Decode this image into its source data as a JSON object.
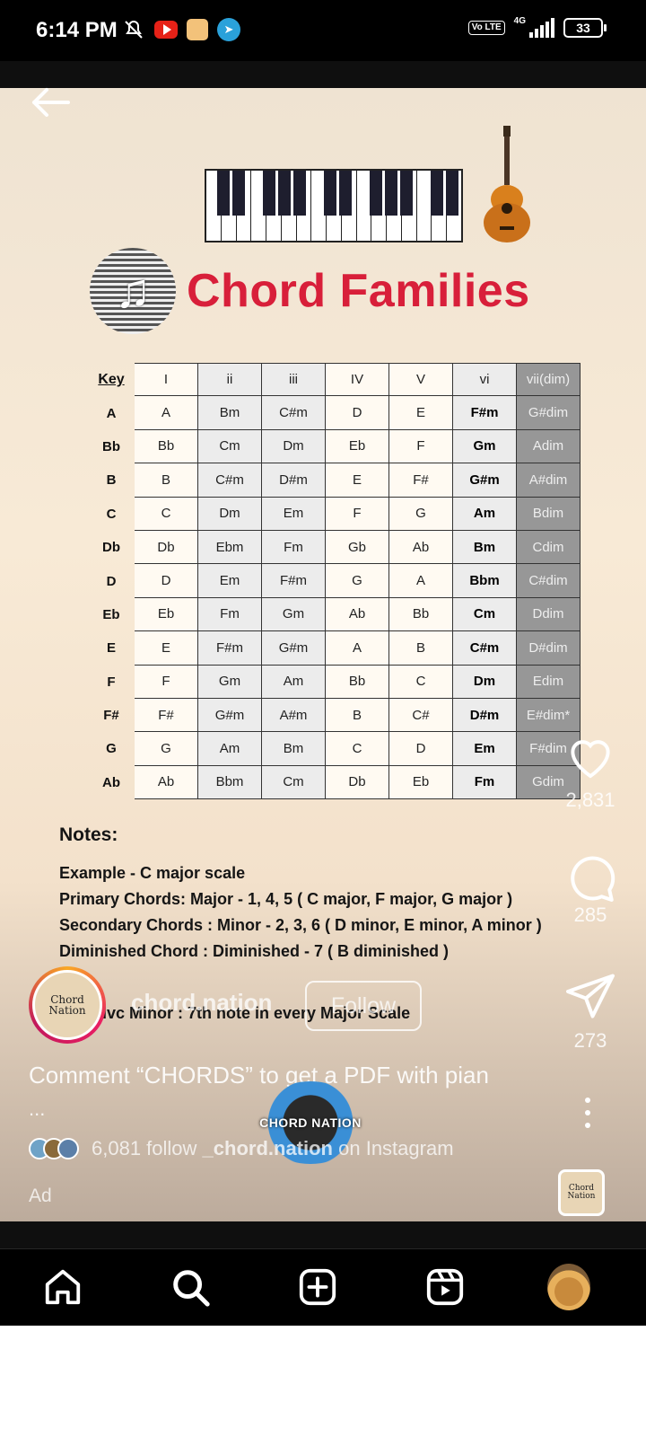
{
  "status_bar": {
    "time": "6:14 PM",
    "network": "4G",
    "volte": "Vo LTE",
    "battery": "33",
    "icons": [
      "mute-icon",
      "youtube-icon",
      "amazon-icon",
      "telegram-icon"
    ]
  },
  "post": {
    "title": "Chord Families",
    "table": {
      "key_header": "Key",
      "degrees": [
        "I",
        "ii",
        "iii",
        "IV",
        "V",
        "vi",
        "vii(dim)"
      ],
      "rows": [
        {
          "key": "A",
          "chords": [
            "A",
            "Bm",
            "C#m",
            "D",
            "E",
            "F#m",
            "G#dim"
          ]
        },
        {
          "key": "Bb",
          "chords": [
            "Bb",
            "Cm",
            "Dm",
            "Eb",
            "F",
            "Gm",
            "Adim"
          ]
        },
        {
          "key": "B",
          "chords": [
            "B",
            "C#m",
            "D#m",
            "E",
            "F#",
            "G#m",
            "A#dim"
          ]
        },
        {
          "key": "C",
          "chords": [
            "C",
            "Dm",
            "Em",
            "F",
            "G",
            "Am",
            "Bdim"
          ]
        },
        {
          "key": "Db",
          "chords": [
            "Db",
            "Ebm",
            "Fm",
            "Gb",
            "Ab",
            "Bm",
            "Cdim"
          ]
        },
        {
          "key": "D",
          "chords": [
            "D",
            "Em",
            "F#m",
            "G",
            "A",
            "Bbm",
            "C#dim"
          ]
        },
        {
          "key": "Eb",
          "chords": [
            "Eb",
            "Fm",
            "Gm",
            "Ab",
            "Bb",
            "Cm",
            "Ddim"
          ]
        },
        {
          "key": "E",
          "chords": [
            "E",
            "F#m",
            "G#m",
            "A",
            "B",
            "C#m",
            "D#dim"
          ]
        },
        {
          "key": "F",
          "chords": [
            "F",
            "Gm",
            "Am",
            "Bb",
            "C",
            "Dm",
            "Edim"
          ]
        },
        {
          "key": "F#",
          "chords": [
            "F#",
            "G#m",
            "A#m",
            "B",
            "C#",
            "D#m",
            "E#dim*"
          ]
        },
        {
          "key": "G",
          "chords": [
            "G",
            "Am",
            "Bm",
            "C",
            "D",
            "Em",
            "F#dim"
          ]
        },
        {
          "key": "Ab",
          "chords": [
            "Ab",
            "Bbm",
            "Cm",
            "Db",
            "Eb",
            "Fm",
            "Gdim"
          ]
        }
      ]
    },
    "notes": {
      "title": "Notes:",
      "lines": [
        "Example - C major scale",
        "Primary Chords: Major - 1, 4, 5 ( C major, F major, G major )",
        "Secondary Chords : Minor - 2, 3, 6 ( D minor, E minor, A minor )",
        "Diminished Chord : Diminished - 7 ( B diminished )"
      ],
      "partial_line": "dvc Minor : 7th note in every Major Scale"
    }
  },
  "account": {
    "name": "chord.nation",
    "avatar_text": [
      "Chord",
      "Nation"
    ],
    "follow_label": "Follow"
  },
  "actions": {
    "likes": "2,831",
    "comments": "285",
    "shares": "273"
  },
  "caption": {
    "text": "Comment “CHORDS” to get a PDF with pian",
    "more": "...",
    "overlay_logo": "CHORD NATION"
  },
  "social_proof": {
    "count": "6,081 follow",
    "account": "_chord.nation",
    "suffix": "on Instagram"
  },
  "ad_label": "Ad",
  "audio_thumb_text": [
    "Chord",
    "Nation"
  ],
  "nav": [
    "home-icon",
    "search-icon",
    "create-icon",
    "reels-icon",
    "profile-avatar"
  ],
  "colors": {
    "title_red": "#d81f3a",
    "dim_column": "#979797",
    "background": "#f8ead6"
  }
}
